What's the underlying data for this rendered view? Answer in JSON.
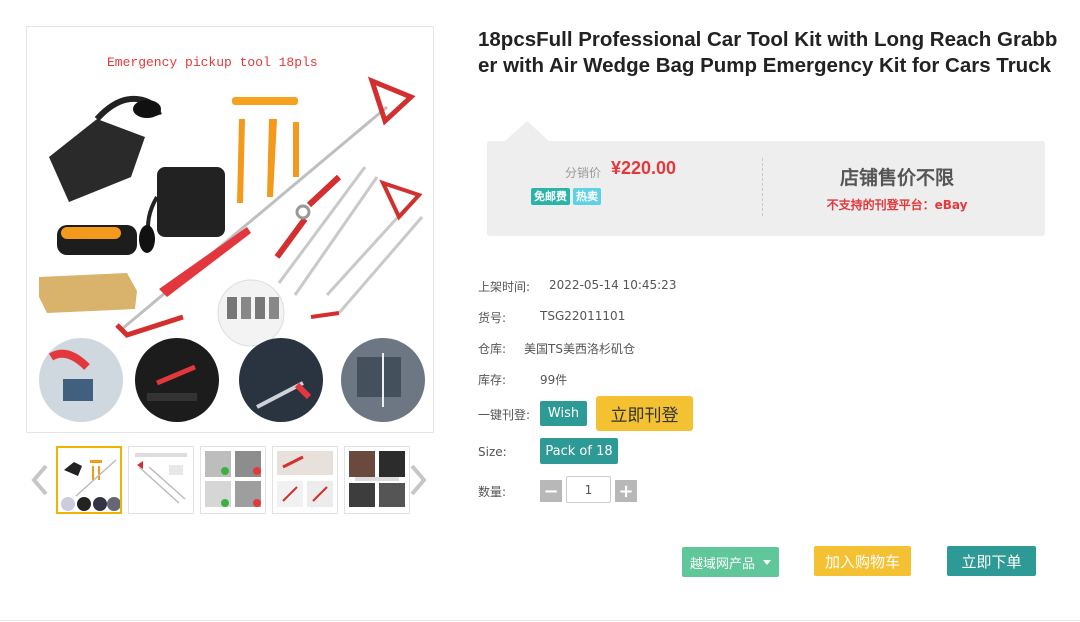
{
  "product": {
    "image_caption": "Emergency pickup tool 18pls",
    "title": "18pcsFull Professional Car Tool Kit with Long Reach Grabber with Air Wedge Bag Pump Emergency Kit for Cars Truck"
  },
  "price": {
    "label": "分销价",
    "value": "¥220.00",
    "badges": [
      "免邮费",
      "热卖"
    ],
    "shop_title": "店铺售价不限",
    "shop_note": "不支持的刊登平台：eBay"
  },
  "attributes": {
    "listed_time_label": "上架时间:",
    "listed_time_value": "2022-05-14 10:45:23",
    "sku_label": "货号:",
    "sku_value": "TSG22011101",
    "warehouse_label": "仓库:",
    "warehouse_value": "美国TS美西洛杉矶仓",
    "stock_label": "库存:",
    "stock_value": "99件",
    "publish_label": "一键刊登:",
    "wish_label": "Wish",
    "publish_button": "立即刊登",
    "size_label": "Size:",
    "size_value": "Pack of 18",
    "quantity_label": "数量:",
    "quantity_value": "1",
    "minus": "−",
    "plus": "+"
  },
  "actions": {
    "yuecheng": "越域网产品",
    "add_cart": "加入购物车",
    "buy_now": "立即下单"
  },
  "thumbnails": [
    "thumb-1",
    "thumb-2",
    "thumb-3",
    "thumb-4",
    "thumb-5"
  ],
  "colors": {
    "price_red": "#e4393c",
    "teal": "#2e9a95",
    "yellow": "#f3c132",
    "green": "#5fc79a"
  }
}
